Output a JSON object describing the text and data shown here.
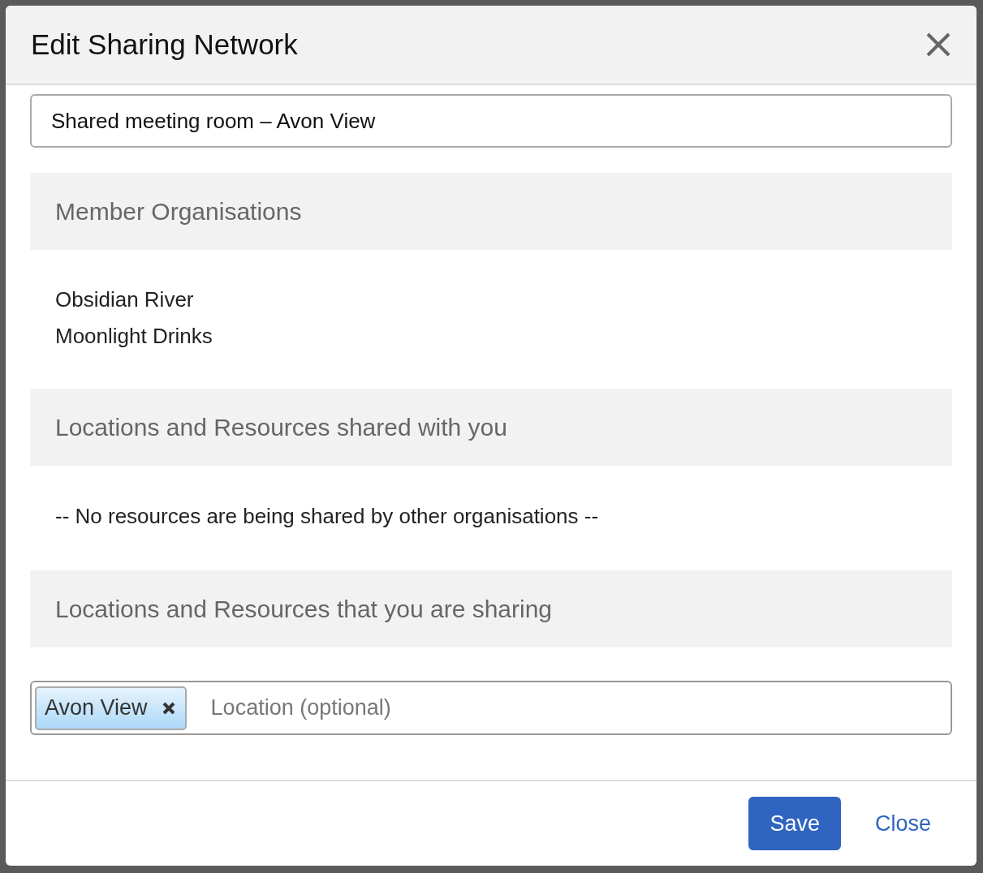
{
  "dialog": {
    "title": "Edit Sharing Network",
    "name_field": {
      "value": "Shared meeting room – Avon View"
    },
    "sections": [
      {
        "heading": "Member Organisations",
        "kind": "list",
        "items": [
          "Obsidian River",
          "Moonlight Drinks"
        ]
      },
      {
        "heading": "Locations and Resources shared with you",
        "kind": "note",
        "text": "-- No resources are being shared by other organisations --"
      },
      {
        "heading": "Locations and Resources that you are sharing",
        "kind": "tags",
        "tags": [
          {
            "label": "Avon View"
          }
        ],
        "placeholder": "Location (optional)"
      }
    ],
    "buttons": [
      {
        "label": "Save",
        "kind": "primary"
      },
      {
        "label": "Close",
        "kind": "link"
      }
    ]
  }
}
